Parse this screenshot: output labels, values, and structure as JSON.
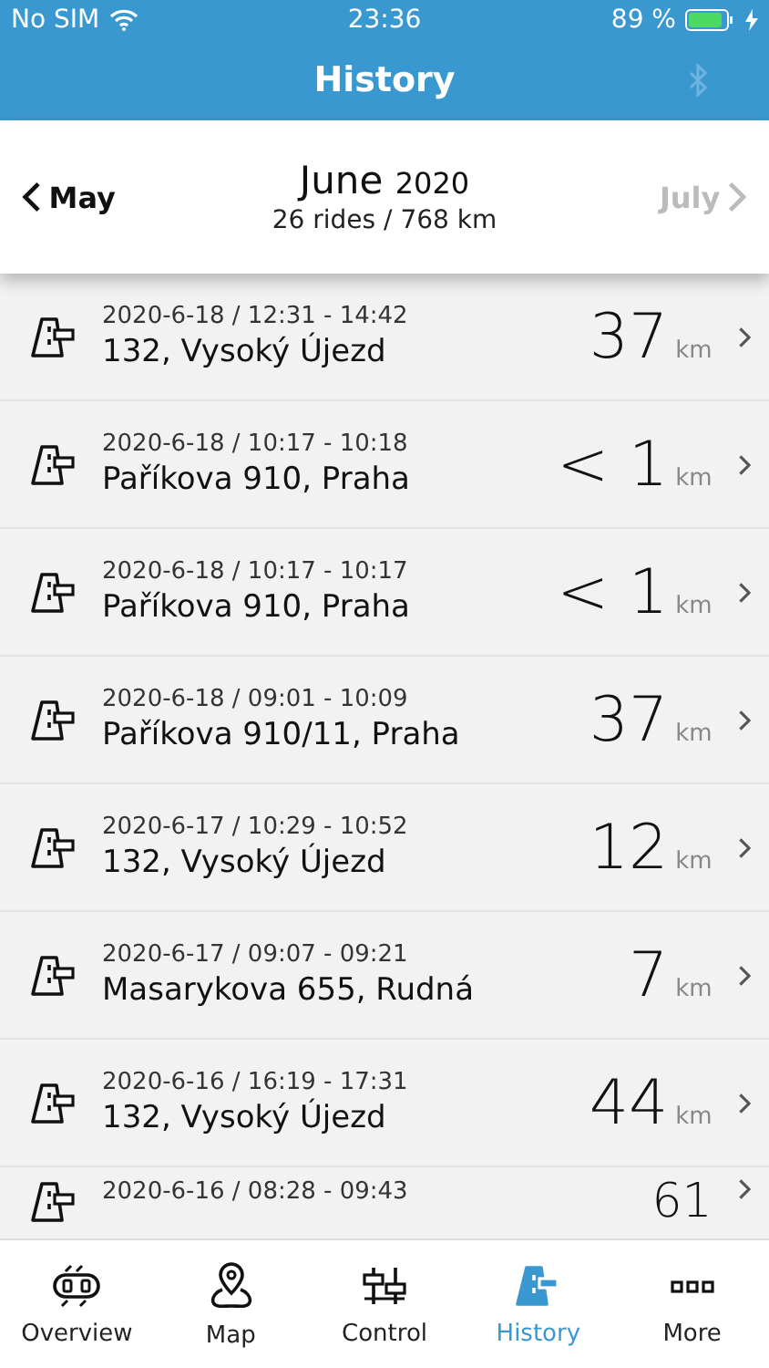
{
  "status_bar": {
    "carrier": "No SIM",
    "time": "23:36",
    "battery": "89 %"
  },
  "nav_bar": {
    "title": "History"
  },
  "month_header": {
    "previous": "May",
    "month": "June",
    "year": "2020",
    "summary": "26 rides / 768 km",
    "next": "July",
    "next_disabled": true
  },
  "rides": [
    {
      "kind": "full",
      "time": "2020-6-18 / 12:31 - 14:42",
      "place": "132, Vysoký Újezd",
      "distance": "37",
      "unit": "km"
    },
    {
      "kind": "full",
      "time": "2020-6-18 / 10:17 - 10:18",
      "place": "Paříkova 910, Praha",
      "distance": "< 1",
      "unit": "km"
    },
    {
      "kind": "full",
      "time": "2020-6-18 / 10:17 - 10:17",
      "place": "Paříkova 910, Praha",
      "distance": "< 1",
      "unit": "km"
    },
    {
      "kind": "full",
      "time": "2020-6-18 / 09:01 - 10:09",
      "place": "Paříkova 910/11, Praha",
      "distance": "37",
      "unit": "km"
    },
    {
      "kind": "full",
      "time": "2020-6-17 / 10:29 - 10:52",
      "place": "132, Vysoký Újezd",
      "distance": "12",
      "unit": "km"
    },
    {
      "kind": "full",
      "time": "2020-6-17 / 09:07 - 09:21",
      "place": "Masarykova 655, Rudná",
      "distance": "7",
      "unit": "km"
    },
    {
      "kind": "full",
      "time": "2020-6-16 / 16:19 - 17:31",
      "place": "132, Vysoký Újezd",
      "distance": "44",
      "unit": "km"
    },
    {
      "kind": "partial",
      "time": "2020-6-16 / 08:28 - 09:43",
      "distance": "61"
    }
  ],
  "tab_bar": [
    {
      "kind": "overview",
      "label": "Overview",
      "selected": false
    },
    {
      "kind": "map",
      "label": "Map",
      "selected": false
    },
    {
      "kind": "control",
      "label": "Control",
      "selected": false
    },
    {
      "kind": "history",
      "label": "History",
      "selected": true
    },
    {
      "kind": "more",
      "label": "More",
      "selected": false
    }
  ]
}
